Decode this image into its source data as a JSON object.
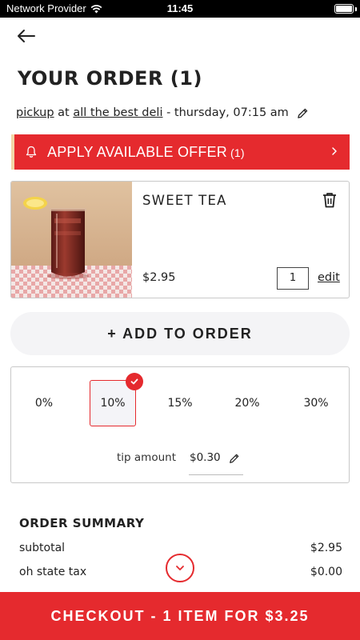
{
  "status_bar": {
    "carrier": "Network Provider",
    "time": "11:45",
    "battery_level": 1.0
  },
  "header": {
    "back_icon": "back-arrow-icon",
    "title": "YOUR ORDER (1)"
  },
  "pickup": {
    "mode": "pickup",
    "at_word": "at",
    "location": "all the best deli",
    "datetime": " - thursday, 07:15 am",
    "edit_icon": "pencil-icon"
  },
  "offer": {
    "label": "APPLY AVAILABLE OFFER",
    "count": "(1)",
    "icon": "bell-icon",
    "chevron": "chevron-right-icon"
  },
  "items": [
    {
      "name": "SWEET TEA",
      "price": "$2.95",
      "quantity": "1",
      "edit_label": "edit",
      "delete_icon": "trash-icon",
      "image": "iced-tea-glass-photo"
    }
  ],
  "add_to_order": {
    "label": "+ ADD TO ORDER"
  },
  "tip": {
    "options": [
      "0%",
      "10%",
      "15%",
      "20%",
      "30%"
    ],
    "selected": "10%",
    "amount_label": "tip amount",
    "amount_value": "$0.30"
  },
  "summary": {
    "title": "ORDER SUMMARY",
    "rows": [
      {
        "label": "subtotal",
        "value": "$2.95"
      },
      {
        "label": "oh state tax",
        "value": "$0.00"
      }
    ],
    "expand_icon": "chevron-down-circle-icon"
  },
  "checkout": {
    "label": "CHECKOUT - 1 ITEM FOR $3.25"
  },
  "colors": {
    "accent": "#e52a2e",
    "button_bg": "#f4f4f6",
    "text": "#222222"
  }
}
